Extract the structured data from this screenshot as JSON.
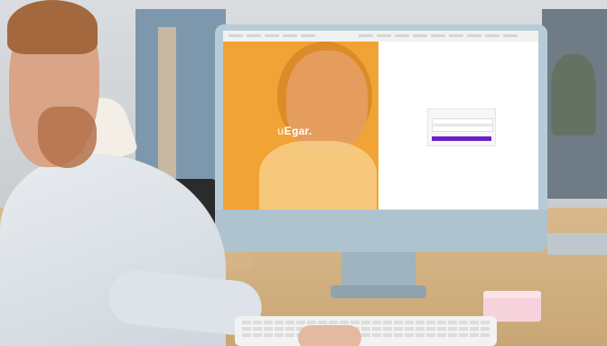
{
  "brand": {
    "logo_letter": "u",
    "logo_rest": "Egar."
  },
  "colors": {
    "brand_orange": "#f1a435",
    "button_purple": "#6b1fc7"
  }
}
